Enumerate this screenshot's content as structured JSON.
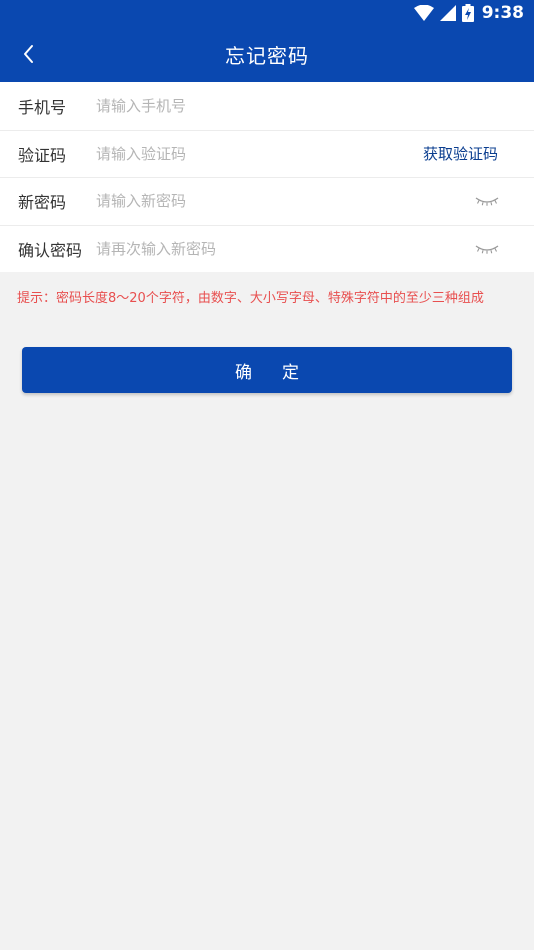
{
  "status_bar": {
    "time": "9:38"
  },
  "header": {
    "title": "忘记密码",
    "back_icon": "chevron-left-icon"
  },
  "form": {
    "phone": {
      "label": "手机号",
      "placeholder": "请输入手机号"
    },
    "code": {
      "label": "验证码",
      "placeholder": "请输入验证码",
      "get_code_label": "获取验证码"
    },
    "new_password": {
      "label": "新密码",
      "placeholder": "请输入新密码",
      "toggle_icon": "eye-closed-icon"
    },
    "confirm_password": {
      "label": "确认密码",
      "placeholder": "请再次输入新密码",
      "toggle_icon": "eye-closed-icon"
    }
  },
  "hint": "提示：密码长度8～20个字符，由数字、大小写字母、特殊字符中的至少三种组成",
  "confirm_button": "确定",
  "colors": {
    "primary": "#0a48b0",
    "hint": "#e84f4f",
    "link": "#0a3d8f"
  }
}
